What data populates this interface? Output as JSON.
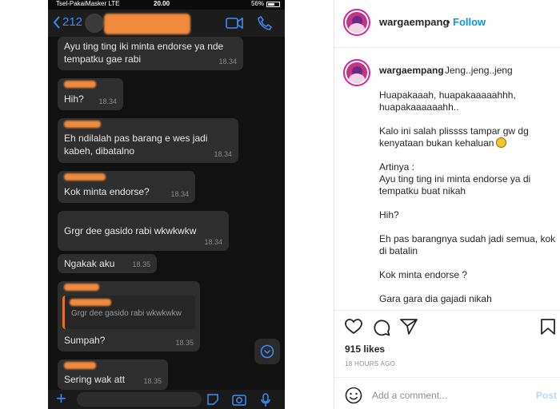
{
  "screenshot": {
    "status": {
      "carrier": "Tsel-PakaiMasker",
      "network": "LTE",
      "time": "20.00",
      "battery": "56%"
    },
    "header": {
      "back_count": "212"
    },
    "messages": [
      {
        "kind": "outgoing",
        "text": "Ayu ting ting iki minta endorse ya nde tempatku gae rabi",
        "time": "18.34"
      },
      {
        "kind": "incoming",
        "text": "Hih?",
        "time": "18.34"
      },
      {
        "kind": "incoming",
        "text": "Eh ndilalah pas barang e wes jadi kabeh, dibatalno",
        "time": "18.34"
      },
      {
        "kind": "incoming",
        "text": "Kok minta endorse?",
        "time": "18.34"
      },
      {
        "kind": "outgoing",
        "text": "Grgr dee gasido rabi wkwkwkw",
        "time": "18.34"
      },
      {
        "kind": "outgoing",
        "text": "Ngakak aku",
        "time": "18.35"
      },
      {
        "kind": "incoming-reply",
        "quote": "Grgr dee gasido rabi wkwkwkw",
        "text": "Sumpah?",
        "time": "18.35"
      },
      {
        "kind": "incoming",
        "text": "Sering wak att",
        "time": "18.35"
      }
    ]
  },
  "instagram": {
    "username": "wargaempang",
    "dot": "•",
    "follow_label": "Follow",
    "caption_first": "Jeng..jeng..jeng",
    "caption": [
      "Huapakaaah, huapakaaaaahhh,\nhuapakaaaaaahh..",
      "Kalo ini salah plissss tampar gw dg kenyataan bukan kehaluan",
      "Artinya :\nAyu ting ting ini minta endorse ya di tempatku buat nikah",
      "Hih?",
      "Eh pas barangnya sudah jadi semua, kok di batalin",
      "Kok minta endorse ?",
      "Gara gara dia gajadi nikah"
    ],
    "likes": "915 likes",
    "time_ago": "18 HOURS AGO",
    "comment_placeholder": "Add a comment...",
    "post_label": "Post",
    "colors": {
      "accent": "#0095f6",
      "avatar_ring": "#d6249f",
      "redaction": "#f08a3c",
      "whatsapp_blue": "#3c8ef5"
    },
    "icons": [
      "heart-icon",
      "comment-icon",
      "share-icon",
      "bookmark-icon",
      "emoji-icon"
    ]
  }
}
